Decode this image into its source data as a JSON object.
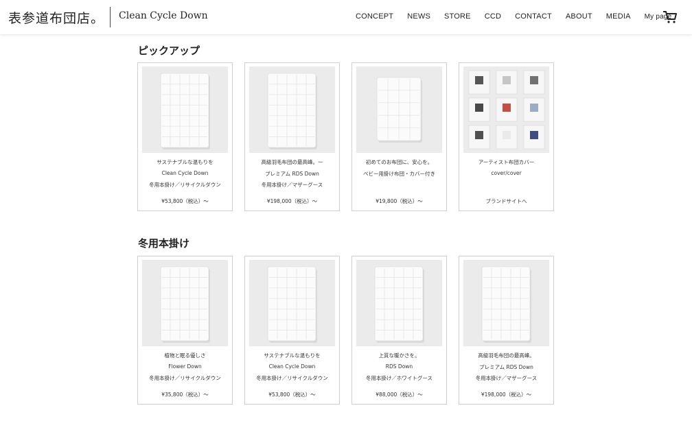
{
  "header": {
    "logo_jp": "表参道布団店。",
    "logo_en": "Clean Cycle Down",
    "nav": [
      "CONCEPT",
      "NEWS",
      "STORE",
      "CCD",
      "CONTACT",
      "ABOUT",
      "MEDIA"
    ],
    "mypage": "My page",
    "cart_icon": "cart-icon"
  },
  "sections": [
    {
      "title": "ピックアップ",
      "cards": [
        {
          "lines": [
            "サステナブルな温もりを",
            "Clean Cycle Down",
            "冬用本掛け／リサイクルダウン"
          ],
          "price": "¥53,800（税込）〜",
          "image": "duvet-long"
        },
        {
          "lines": [
            "高級羽毛布団の最高峰。ー",
            "プレミアム RDS Down",
            "冬用本掛け／マザーグース"
          ],
          "price": "¥198,000（税込）〜",
          "image": "duvet-long"
        },
        {
          "lines": [
            "初めてのお布団に、安心を。",
            "ベビー用掛け布団・カバー付き",
            ""
          ],
          "price": "¥19,800（税込）〜",
          "image": "duvet-baby"
        },
        {
          "lines": [
            "アーティスト布団カバー",
            "cover/cover",
            ""
          ],
          "price": "ブランドサイトへ",
          "image": "cover-grid"
        }
      ]
    },
    {
      "title": "冬用本掛け",
      "cards": [
        {
          "lines": [
            "植物と眠る優しさ",
            "Flower Down",
            "冬用本掛け／リサイクルダウン"
          ],
          "price": "¥35,800（税込）〜",
          "image": "duvet-long"
        },
        {
          "lines": [
            "サステナブルな温もりを",
            "Clean Cycle Down",
            "冬用本掛け／リサイクルダウン"
          ],
          "price": "¥53,800（税込）〜",
          "image": "duvet-long"
        },
        {
          "lines": [
            "上質な暖かさを。",
            "RDS Down",
            "冬用本掛け／ホワイトグース"
          ],
          "price": "¥88,000（税込）〜",
          "image": "duvet-long"
        },
        {
          "lines": [
            "高級羽毛布団の最高峰。",
            "プレミアム RDS Down",
            "冬用本掛け／マザーグース"
          ],
          "price": "¥198,000（税込）〜",
          "image": "duvet-long"
        }
      ]
    }
  ]
}
